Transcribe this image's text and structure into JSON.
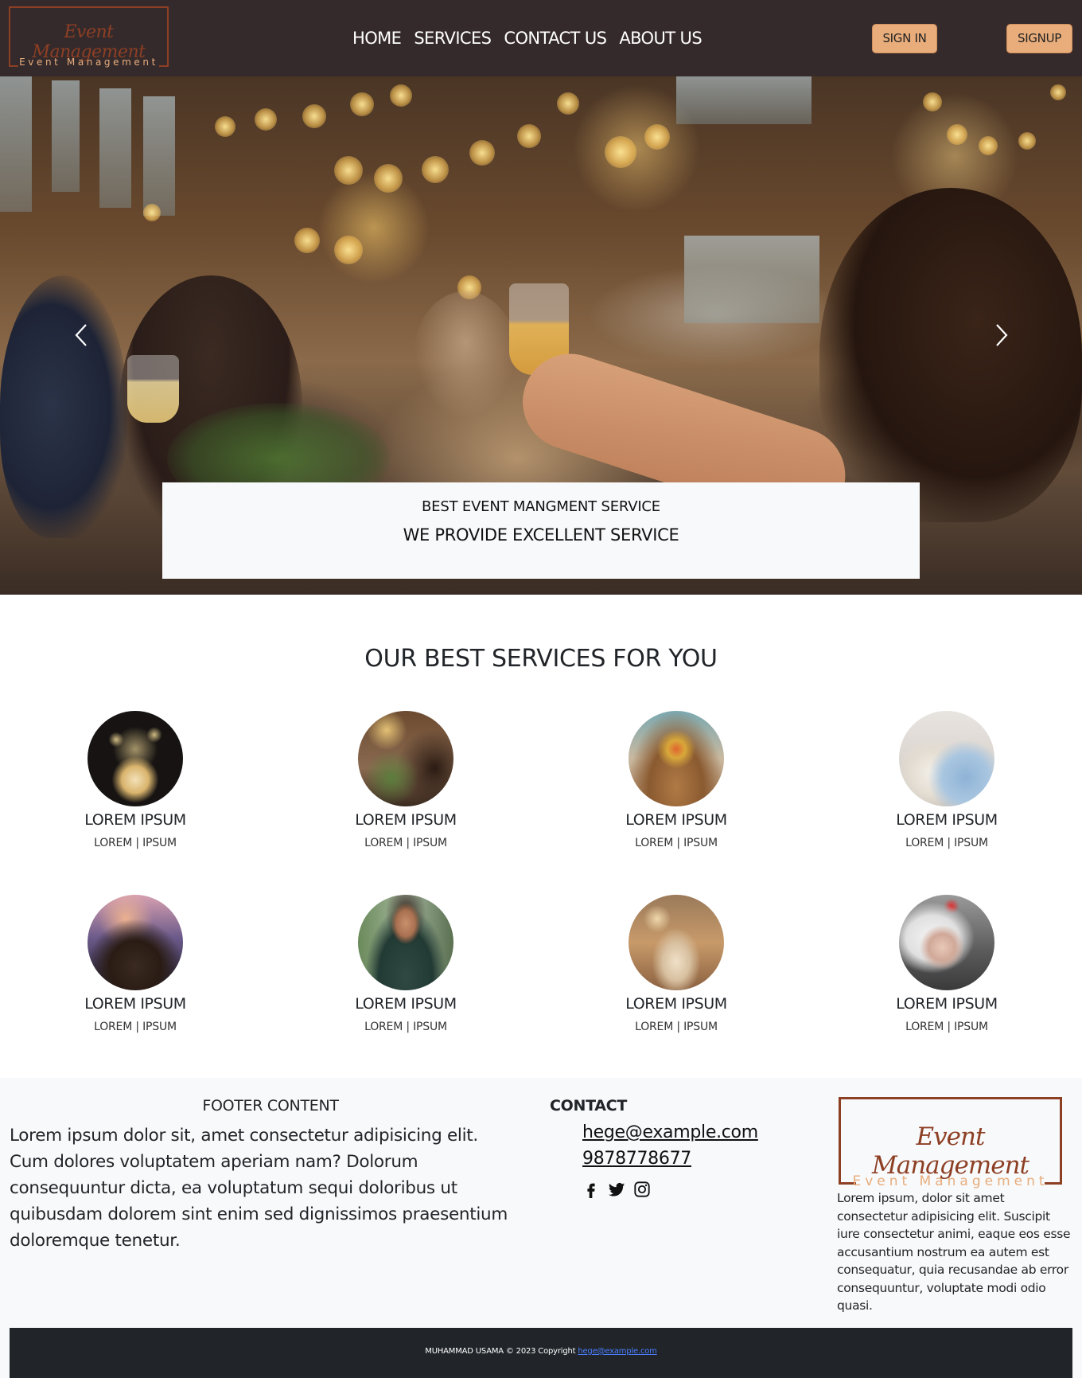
{
  "brand": {
    "logo_script": "Event Management",
    "logo_sub": "Event Management"
  },
  "nav": {
    "items": [
      {
        "label": "HOME"
      },
      {
        "label": "SERVICES"
      },
      {
        "label": "CONTACT US"
      },
      {
        "label": "ABOUT US"
      }
    ],
    "signin_label": "SIGN IN",
    "signup_label": "SIGNUP"
  },
  "hero": {
    "caption_title": "BEST EVENT MANGMENT SERVICE",
    "caption_text": "WE PROVIDE EXCELLENT SERVICE",
    "prev_icon": "chevron-left-icon",
    "next_icon": "chevron-right-icon"
  },
  "services": {
    "title": "OUR BEST SERVICES FOR YOU",
    "items": [
      {
        "title": "LOREM IPSUM",
        "sub": "LOREM | IPSUM",
        "image": "wedding-arch-lights"
      },
      {
        "title": "LOREM IPSUM",
        "sub": "LOREM | IPSUM",
        "image": "toast-celebration"
      },
      {
        "title": "LOREM IPSUM",
        "sub": "LOREM | IPSUM",
        "image": "dinner-table-flowers"
      },
      {
        "title": "LOREM IPSUM",
        "sub": "LOREM | IPSUM",
        "image": "wedding-dresses"
      },
      {
        "title": "LOREM IPSUM",
        "sub": "LOREM | IPSUM",
        "image": "car-driving"
      },
      {
        "title": "LOREM IPSUM",
        "sub": "LOREM | IPSUM",
        "image": "event-planner-woman"
      },
      {
        "title": "LOREM IPSUM",
        "sub": "LOREM | IPSUM",
        "image": "banquet-hall"
      },
      {
        "title": "LOREM IPSUM",
        "sub": "LOREM | IPSUM",
        "image": "beauty-spa"
      }
    ]
  },
  "footer": {
    "heading": "FOOTER CONTENT",
    "text": "Lorem ipsum dolor sit, amet consectetur adipisicing elit. Cum dolores voluptatem aperiam nam? Dolorum consequuntur dicta, ea voluptatum sequi doloribus ut quibusdam dolorem sint enim sed dignissimos praesentium doloremque tenetur.",
    "contact_heading": "CONTACT",
    "email": "hege@example.com",
    "phone": "9878778677",
    "social_icons": [
      "facebook-icon",
      "twitter-icon",
      "instagram-icon"
    ],
    "logo_script": "Event Management",
    "logo_sub": "Event Management",
    "side_text": "Lorem ipsum, dolor sit amet consectetur adipisicing elit. Suscipit iure consectetur animi, eaque eos esse accusantium nostrum ea autem est consequatur, quia recusandae ab error consequuntur, voluptate modi odio quasi.",
    "copyright_prefix": "MUHAMMAD USAMA © 2023 Copyright",
    "copyright_link": "hege@example.com"
  },
  "colors": {
    "navbar_bg": "#352a2b",
    "accent_button": "#e8ad7b",
    "logo_brown": "#8d3f24",
    "logo_peach": "#e7ad7d",
    "footer_bg": "#f8f9fa",
    "bottom_bar": "#212529",
    "link_blue": "#4a7dff"
  }
}
